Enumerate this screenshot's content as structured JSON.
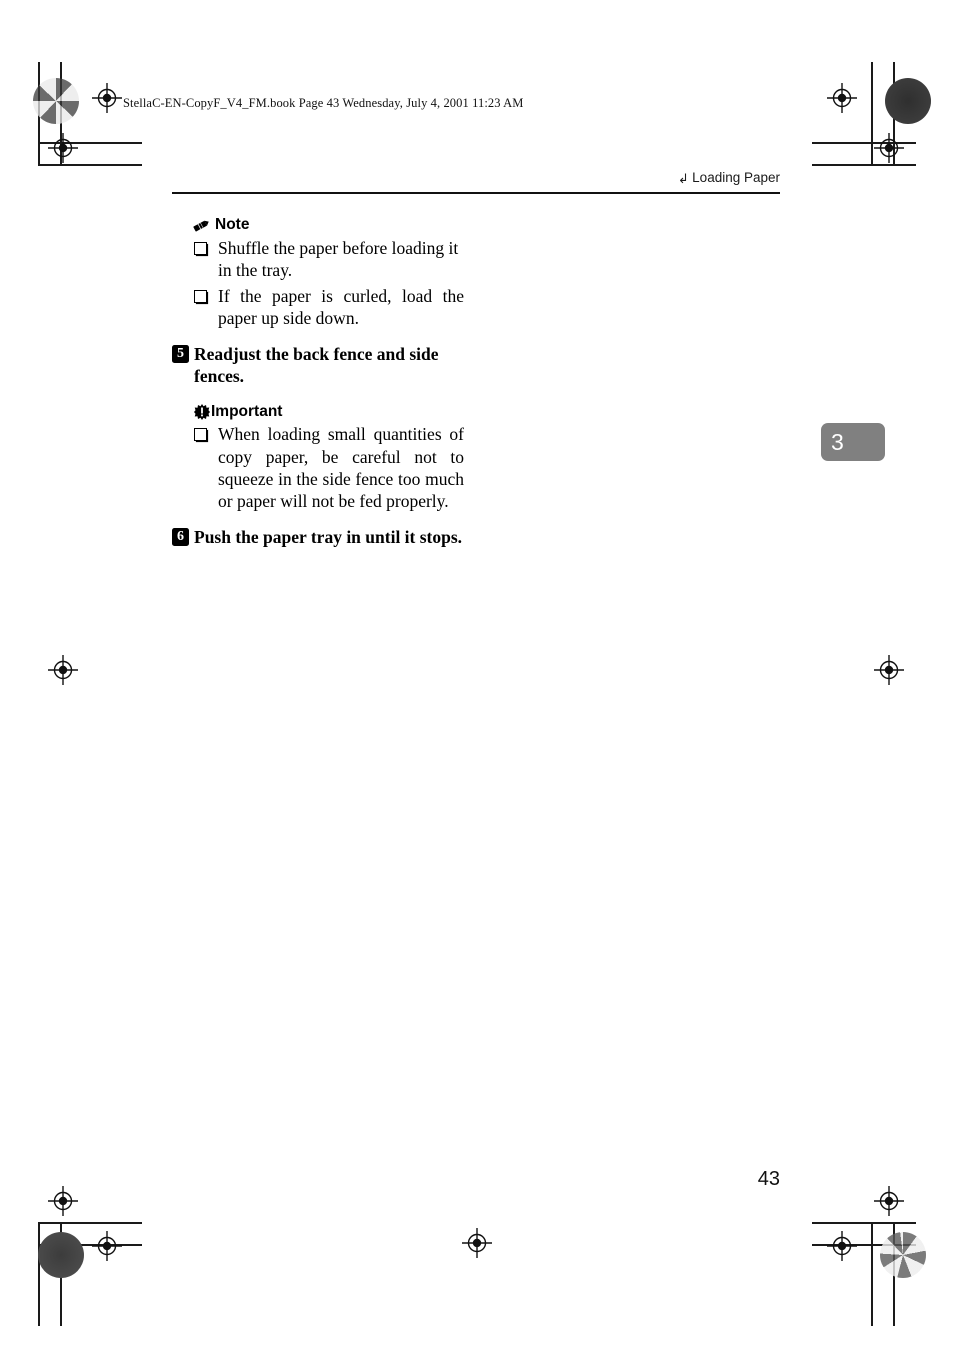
{
  "document": {
    "file_slug": "StellaC-EN-CopyF_V4_FM.book  Page 43  Wednesday, July 4, 2001  11:23 AM",
    "running_header": "Loading Paper",
    "running_header_icon": "corner-arrow-icon",
    "chapter_tab": "3",
    "page_number": "43"
  },
  "note": {
    "icon": "pencil-icon",
    "title": "Note",
    "items": [
      "Shuffle the paper before loading it in the tray.",
      "If the paper is curled, load the paper up side down."
    ]
  },
  "steps": [
    {
      "number": "5",
      "text": "Readjust the back fence and side fences."
    },
    {
      "number": "6",
      "text": "Push the paper tray in until it stops."
    }
  ],
  "important": {
    "icon": "starburst-exclamation-icon",
    "title": "Important",
    "items": [
      "When loading small quantities of copy paper, be careful not to squeeze in the side fence too much or paper will not be fed properly."
    ]
  },
  "colors": {
    "chapter_tab_bg": "#808080",
    "text": "#000000",
    "rule": "#111111"
  }
}
